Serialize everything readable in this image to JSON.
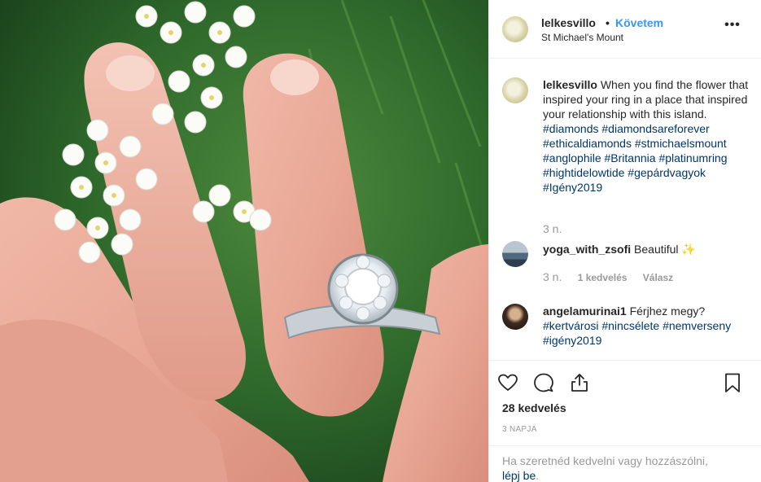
{
  "header": {
    "username": "lelkesvillo",
    "separator": "•",
    "follow_label": "Követem",
    "location": "St Michael's Mount",
    "more_label": "•••"
  },
  "caption": {
    "username": "lelkesvillo",
    "text": "When you find the flower that inspired your ring in a place that inspired your relationship with this island.",
    "hashtags": [
      "#diamonds",
      "#diamondsareforever",
      "#ethicaldiamonds",
      "#stmichaelsmount",
      "#anglophile",
      "#Britannia",
      "#platinumring",
      "#hightidelowtide",
      "#gepárdvagyok",
      "#Igény2019"
    ],
    "time": "3 n."
  },
  "comments": [
    {
      "username": "yoga_with_zsofi",
      "text": "Beautiful ✨",
      "time": "3 n.",
      "likes": "1 kedvelés",
      "reply": "Válasz"
    },
    {
      "username": "angelamurinai1",
      "text": "Férjhez megy?",
      "hashtags": [
        "#kertvárosi",
        "#nincsélete",
        "#nemverseny",
        "#igény2019"
      ]
    }
  ],
  "actions": {
    "like_icon": "heart-icon",
    "comment_icon": "comment-icon",
    "share_icon": "share-icon",
    "save_icon": "bookmark-icon"
  },
  "likes_text": "28 kedvelés",
  "date_text": "3 NAPJA",
  "login_prompt": {
    "text": "Ha szeretnéd kedvelni vagy hozzászólni,",
    "link": "lépj be",
    "suffix": "."
  },
  "colors": {
    "link_blue": "#3897f0",
    "hashtag": "#003569",
    "muted": "#999999"
  }
}
